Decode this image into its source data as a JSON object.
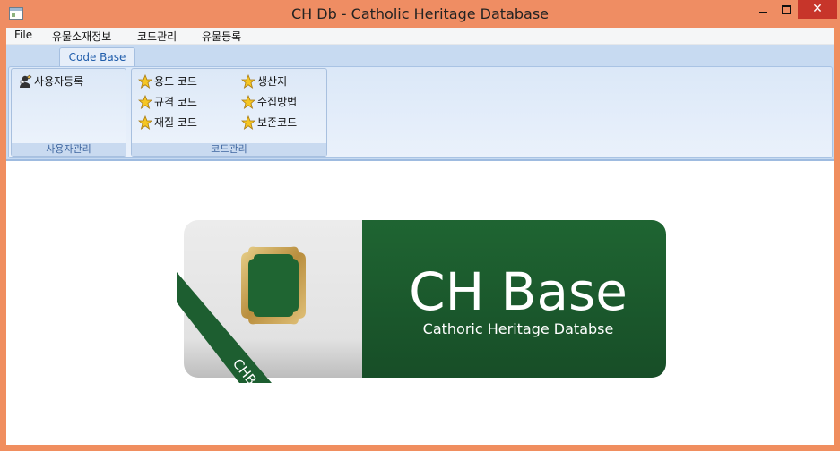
{
  "window": {
    "title": "CH Db - Catholic Heritage Database",
    "close_glyph": "✕"
  },
  "menu": {
    "items": [
      "File",
      "유물소재정보",
      "코드관리",
      "유물등록"
    ]
  },
  "ribbon": {
    "tab": "Code Base",
    "groups": [
      {
        "label": "사용자관리",
        "buttons": [
          {
            "label": "사용자등록",
            "icon": "user-edit-icon"
          }
        ]
      },
      {
        "label": "코드관리",
        "buttons": [
          {
            "label": "용도 코드",
            "icon": "star-icon"
          },
          {
            "label": "규격 코드",
            "icon": "star-icon"
          },
          {
            "label": "재질 코드",
            "icon": "star-icon"
          },
          {
            "label": "생산지",
            "icon": "star-icon"
          },
          {
            "label": "수집방법",
            "icon": "star-icon"
          },
          {
            "label": "보존코드",
            "icon": "star-icon"
          }
        ]
      }
    ]
  },
  "logo": {
    "title": "CH Base",
    "subtitle": "Cathoric  Heritage Databse",
    "ribbon_text": "CHB",
    "colors": {
      "green": "#1d5e30",
      "gold": "#c8a45a",
      "gray": "#e3e3e3"
    }
  }
}
